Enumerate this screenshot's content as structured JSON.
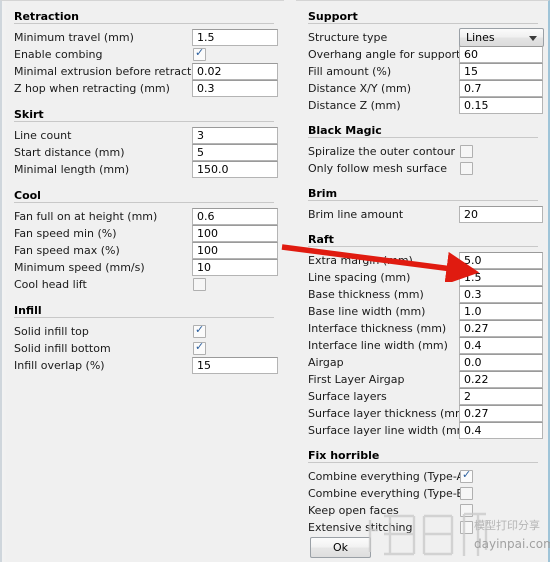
{
  "window": {
    "ok_label": "Ok"
  },
  "left_column": {
    "groups": [
      {
        "title": "Retraction",
        "rows": [
          {
            "label": "Minimum travel (mm)",
            "type": "text",
            "value": "1.5"
          },
          {
            "label": "Enable combing",
            "type": "checkbox",
            "checked": true
          },
          {
            "label": "Minimal extrusion before retracting (mm)",
            "type": "text",
            "value": "0.02"
          },
          {
            "label": "Z hop when retracting (mm)",
            "type": "text",
            "value": "0.3"
          }
        ]
      },
      {
        "title": "Skirt",
        "rows": [
          {
            "label": "Line count",
            "type": "text",
            "value": "3"
          },
          {
            "label": "Start distance (mm)",
            "type": "text",
            "value": "5"
          },
          {
            "label": "Minimal length (mm)",
            "type": "text",
            "value": "150.0"
          }
        ]
      },
      {
        "title": "Cool",
        "rows": [
          {
            "label": "Fan full on at height (mm)",
            "type": "text",
            "value": "0.6"
          },
          {
            "label": "Fan speed min (%)",
            "type": "text",
            "value": "100"
          },
          {
            "label": "Fan speed max (%)",
            "type": "text",
            "value": "100"
          },
          {
            "label": "Minimum speed (mm/s)",
            "type": "text",
            "value": "10"
          },
          {
            "label": "Cool head lift",
            "type": "checkbox",
            "checked": false
          }
        ]
      },
      {
        "title": "Infill",
        "rows": [
          {
            "label": "Solid infill top",
            "type": "checkbox",
            "checked": true
          },
          {
            "label": "Solid infill bottom",
            "type": "checkbox",
            "checked": true
          },
          {
            "label": "Infill overlap (%)",
            "type": "text",
            "value": "15"
          }
        ]
      }
    ]
  },
  "right_column": {
    "groups": [
      {
        "title": "Support",
        "rows": [
          {
            "label": "Structure type",
            "type": "combo",
            "value": "Lines"
          },
          {
            "label": "Overhang angle for support (deg)",
            "type": "text",
            "value": "60"
          },
          {
            "label": "Fill amount (%)",
            "type": "text",
            "value": "15"
          },
          {
            "label": "Distance X/Y (mm)",
            "type": "text",
            "value": "0.7"
          },
          {
            "label": "Distance Z (mm)",
            "type": "text",
            "value": "0.15"
          }
        ]
      },
      {
        "title": "Black Magic",
        "rows": [
          {
            "label": "Spiralize the outer contour",
            "type": "checkbox",
            "checked": false
          },
          {
            "label": "Only follow mesh surface",
            "type": "checkbox",
            "checked": false
          }
        ]
      },
      {
        "title": "Brim",
        "rows": [
          {
            "label": "Brim line amount",
            "type": "text",
            "value": "20"
          }
        ]
      },
      {
        "title": "Raft",
        "rows": [
          {
            "label": "Extra margin (mm)",
            "type": "text",
            "value": "5.0"
          },
          {
            "label": "Line spacing (mm)",
            "type": "text",
            "value": "1.5"
          },
          {
            "label": "Base thickness (mm)",
            "type": "text",
            "value": "0.3"
          },
          {
            "label": "Base line width (mm)",
            "type": "text",
            "value": "1.0"
          },
          {
            "label": "Interface thickness (mm)",
            "type": "text",
            "value": "0.27"
          },
          {
            "label": "Interface line width (mm)",
            "type": "text",
            "value": "0.4"
          },
          {
            "label": "Airgap",
            "type": "text",
            "value": "0.0"
          },
          {
            "label": "First Layer Airgap",
            "type": "text",
            "value": "0.22"
          },
          {
            "label": "Surface layers",
            "type": "text",
            "value": "2"
          },
          {
            "label": "Surface layer thickness (mm)",
            "type": "text",
            "value": "0.27"
          },
          {
            "label": "Surface layer line width (mm)",
            "type": "text",
            "value": "0.4"
          }
        ]
      },
      {
        "title": "Fix horrible",
        "rows": [
          {
            "label": "Combine everything (Type-A)",
            "type": "checkbox",
            "checked": true
          },
          {
            "label": "Combine everything (Type-B)",
            "type": "checkbox",
            "checked": false
          },
          {
            "label": "Keep open faces",
            "type": "checkbox",
            "checked": false
          },
          {
            "label": "Extensive stitching",
            "type": "checkbox",
            "checked": false
          }
        ]
      }
    ]
  },
  "annotation": {
    "arrow_color": "#e01b10",
    "points_at": "Line spacing (mm)"
  },
  "watermark": {
    "logo_text": "打印派",
    "tagline": "模型打印分享",
    "site": "dayinpai.com"
  }
}
